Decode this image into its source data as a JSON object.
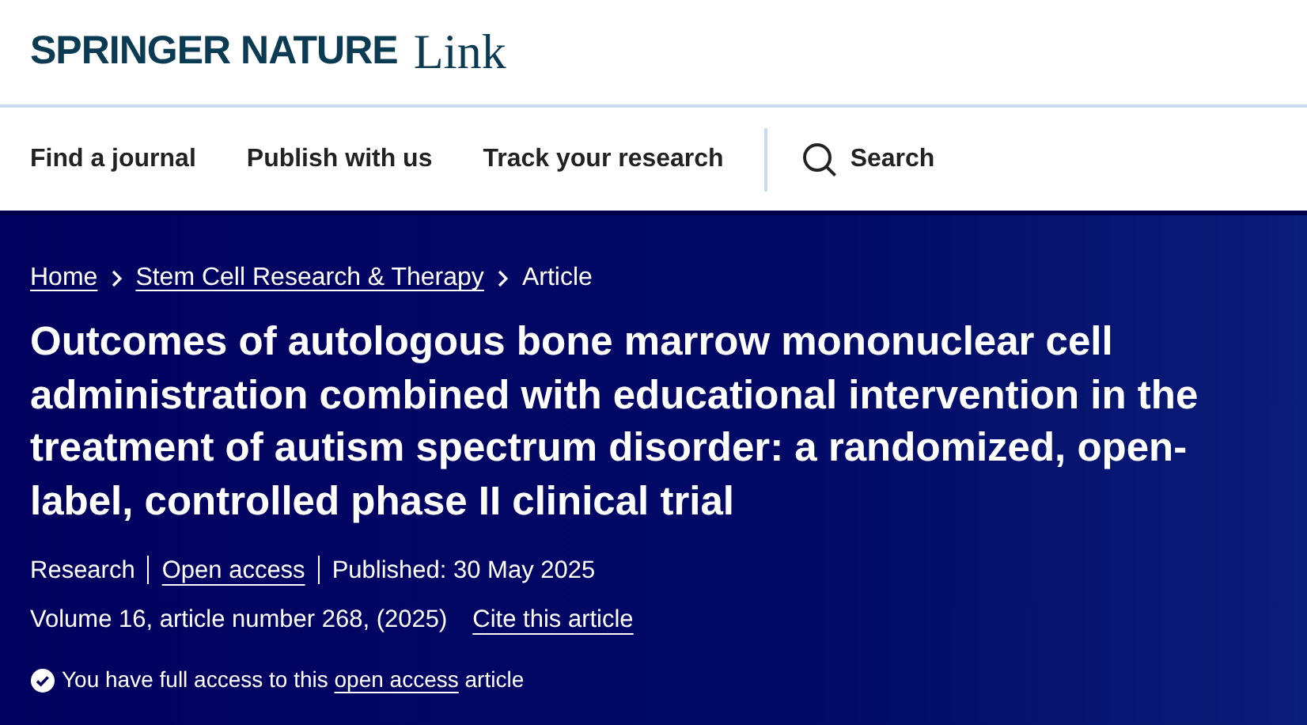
{
  "logo": {
    "brand": "SPRINGER NATURE",
    "product": "Link"
  },
  "nav": [
    {
      "label": "Find a journal"
    },
    {
      "label": "Publish with us"
    },
    {
      "label": "Track your research"
    }
  ],
  "search": {
    "label": "Search"
  },
  "breadcrumbs": [
    {
      "label": "Home"
    },
    {
      "label": "Stem Cell Research & Therapy"
    },
    {
      "label": "Article"
    }
  ],
  "article": {
    "title": "Outcomes of autologous bone marrow mononuclear cell administration combined with educational intervention in the treatment of autism spectrum disorder: a randomized, open-label, controlled phase II clinical trial",
    "meta": [
      {
        "text": "Research",
        "kind": "text"
      },
      {
        "text": "Open access",
        "kind": "link"
      },
      {
        "text": "Published: 30 May 2025",
        "kind": "text"
      }
    ],
    "citation": "Volume 16, article number 268, (2025)",
    "cite_link": "Cite this article",
    "access": {
      "before": "You have full access to this",
      "link": "open access",
      "after": "article"
    }
  }
}
